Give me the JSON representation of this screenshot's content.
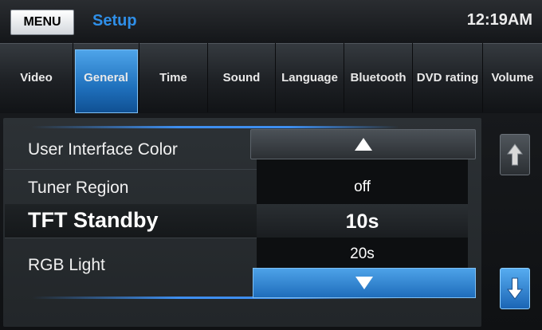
{
  "header": {
    "menu_label": "MENU",
    "title": "Setup",
    "clock": "12:19AM"
  },
  "tabs": [
    {
      "label": "Video",
      "active": false
    },
    {
      "label": "General",
      "active": true
    },
    {
      "label": "Time",
      "active": false
    },
    {
      "label": "Sound",
      "active": false
    },
    {
      "label": "Language",
      "active": false
    },
    {
      "label": "Bluetooth",
      "active": false
    },
    {
      "label": "DVD rating",
      "active": false
    },
    {
      "label": "Volume",
      "active": false
    }
  ],
  "settings": [
    {
      "label": "User Interface Color"
    },
    {
      "label": "Tuner Region"
    },
    {
      "label": "TFT Standby",
      "selected": true
    },
    {
      "label": "RGB Light"
    }
  ],
  "picker": {
    "options": [
      "off",
      "10s",
      "20s"
    ],
    "selected": "10s",
    "up_icon": "triangle-up-icon",
    "down_icon": "triangle-down-icon"
  },
  "scroll": {
    "up_icon": "arrow-up-icon",
    "down_icon": "arrow-down-icon"
  },
  "colors": {
    "accent": "#2f8fe8",
    "active_tab": "#1f70bc"
  }
}
